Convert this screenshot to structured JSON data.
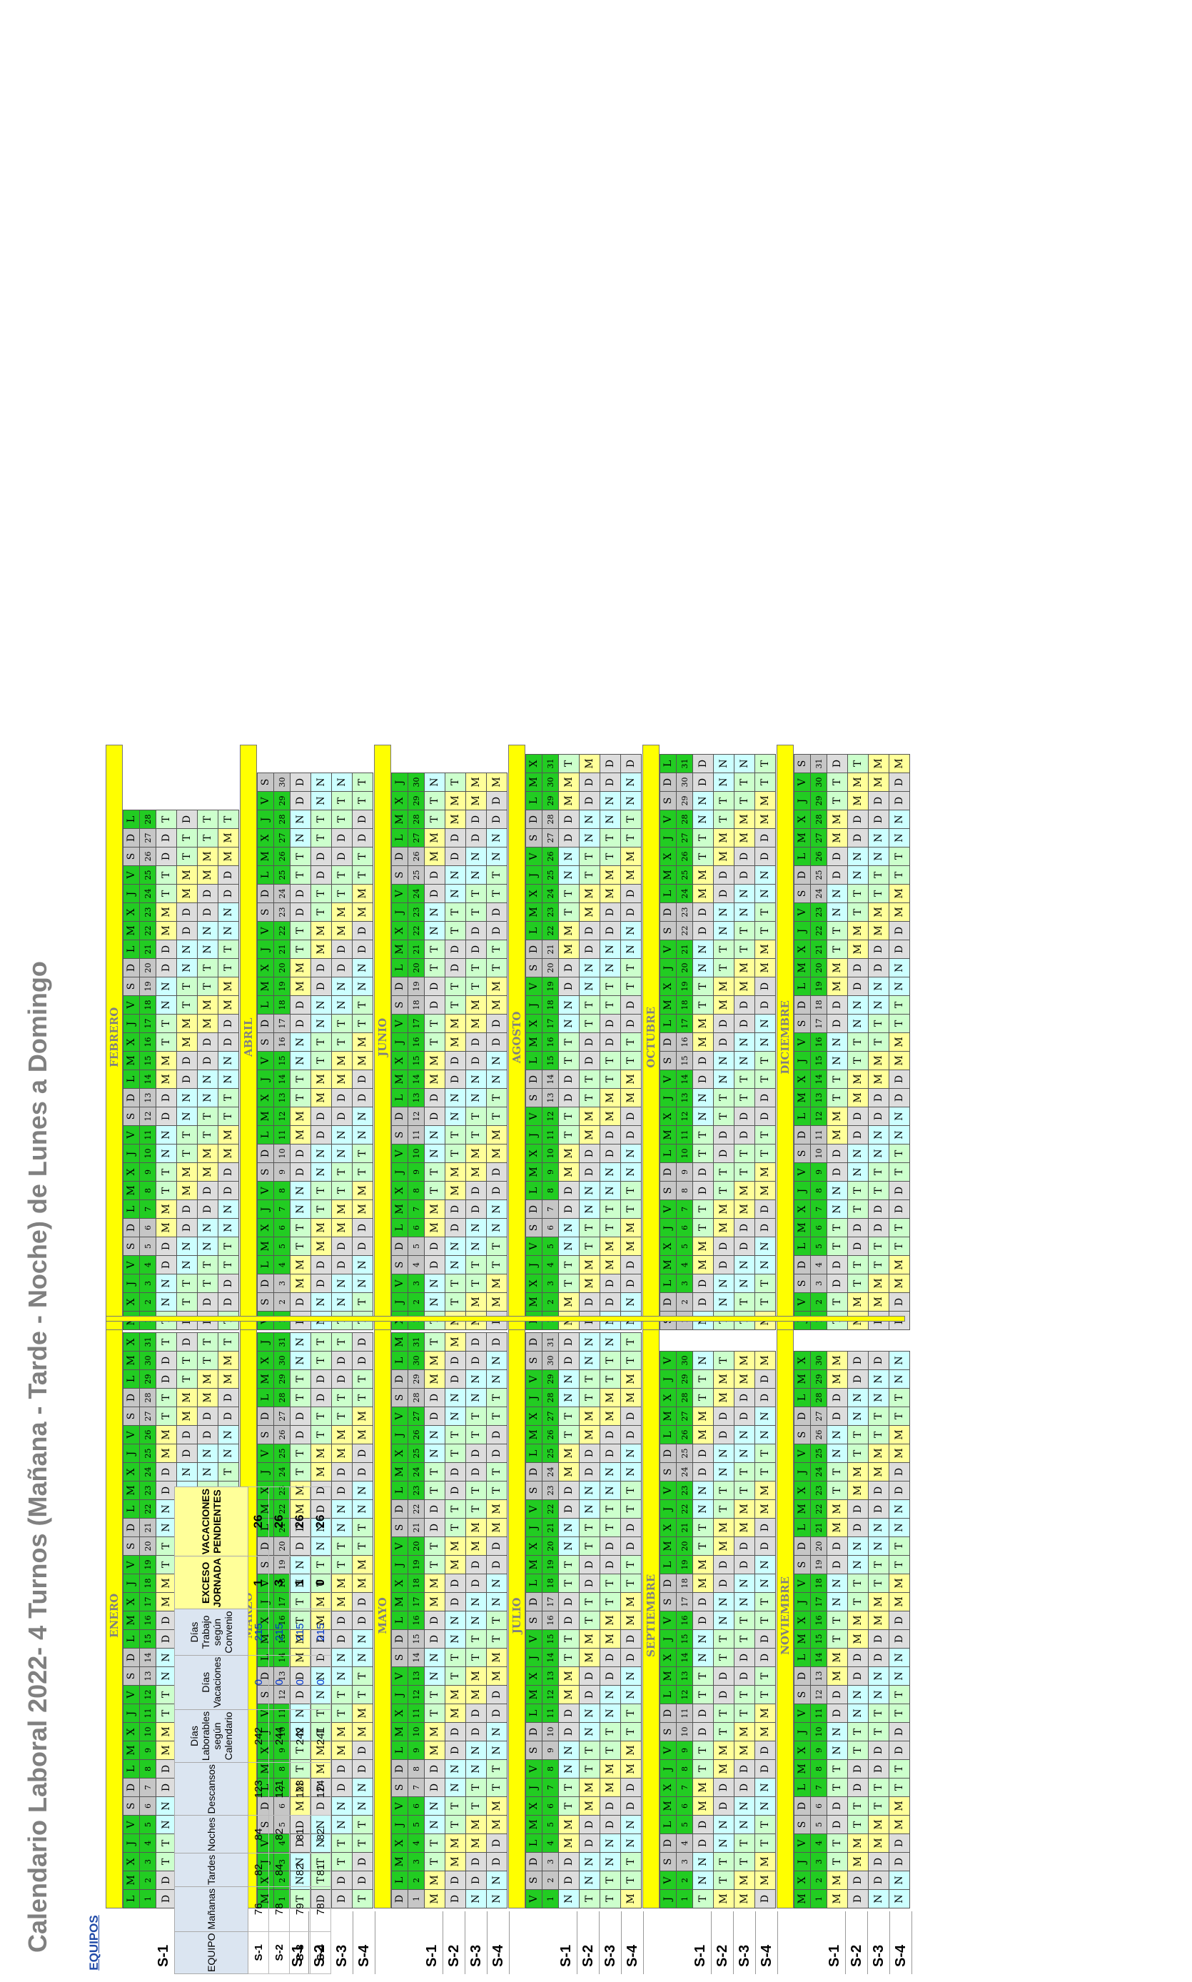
{
  "title": "Calendario Laboral 2022- 4 Turnos (Mañana - Tarde - Noche) de Lunes a Domingo",
  "equipos_header": "EQUIPOS",
  "teams": [
    "S-1",
    "S-2",
    "S-3",
    "S-4"
  ],
  "months": [
    {
      "name": "ENERO",
      "offset": 0,
      "days": 31
    },
    {
      "name": "FEBRERO",
      "offset": 1,
      "days": 28
    },
    {
      "name": "MARZO",
      "offset": 1,
      "days": 31
    },
    {
      "name": "ABRIL",
      "offset": 4,
      "days": 30
    },
    {
      "name": "MAYO",
      "offset": 6,
      "days": 31
    },
    {
      "name": "JUNIO",
      "offset": 2,
      "days": 30
    },
    {
      "name": "JULIO",
      "offset": 4,
      "days": 31
    },
    {
      "name": "AGOSTO",
      "offset": 0,
      "days": 31
    },
    {
      "name": "SEPTIEMBRE",
      "offset": 3,
      "days": 30
    },
    {
      "name": "OCTUBRE",
      "offset": 5,
      "days": 31
    },
    {
      "name": "NOVIEMBRE",
      "offset": 1,
      "days": 30
    },
    {
      "name": "DICIEMBRE",
      "offset": 3,
      "days": 31
    }
  ],
  "dow": [
    "L",
    "M",
    "X",
    "J",
    "V",
    "S",
    "D"
  ],
  "rotation": [
    "D",
    "D",
    "T",
    "T",
    "N",
    "N",
    "D",
    "D",
    "M",
    "M",
    "T",
    "T",
    "N",
    "N",
    "D",
    "D",
    "M",
    "M",
    "T",
    "T",
    "N",
    "N",
    "D",
    "D",
    "M",
    "M",
    "T",
    "T"
  ],
  "team_shift": [
    0,
    26,
    25,
    24
  ],
  "summary": {
    "headers": [
      "EQUIPO",
      "Mañanas",
      "Tardes",
      "Noches",
      "Descansos",
      "Días Laborables según Calendario",
      "Días Vacaciones",
      "Días Trabajo según Convenio",
      "EXCESO JORNADA",
      "VACACIONES PENDIENTES"
    ],
    "rows": [
      [
        "S-1",
        "76",
        "82",
        "84",
        "123",
        "242",
        "0",
        "215",
        "1",
        "26"
      ],
      [
        "S-2",
        "78",
        "84",
        "82",
        "121",
        "244",
        "0",
        "215",
        "3",
        "26"
      ],
      [
        "S-3",
        "79",
        "82",
        "81",
        "123",
        "242",
        "0",
        "215",
        "1",
        "26"
      ],
      [
        "S-4",
        "78",
        "81",
        "82",
        "124",
        "241",
        "0",
        "215",
        "0",
        "26"
      ]
    ]
  },
  "colors": {
    "weekday": "#22cc22",
    "weekend": "#c6c6c6",
    "M": "#ffff99",
    "T": "#ccffcc",
    "N": "#ccffff",
    "D": "#dddddd",
    "month_bar": "#ffff00"
  }
}
